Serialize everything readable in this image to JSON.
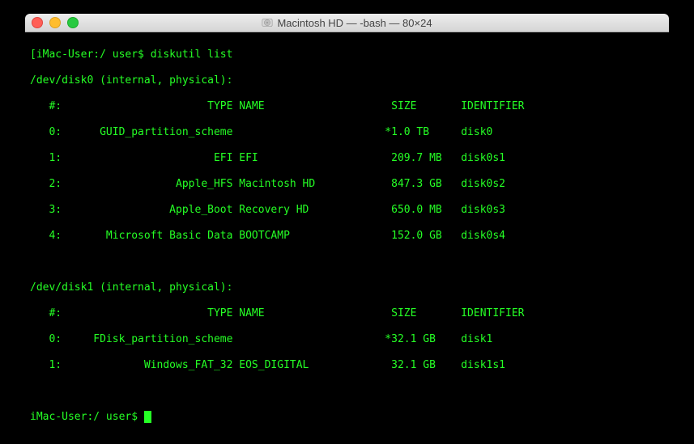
{
  "window": {
    "title": "Macintosh HD — -bash — 80×24"
  },
  "prompt1": {
    "full": "[iMac-User:/ user$ diskutil list"
  },
  "prompt2": {
    "full": "iMac-User:/ user$ "
  },
  "disk0": {
    "header": "/dev/disk0 (internal, physical):",
    "col_header": "   #:                       TYPE NAME                    SIZE       IDENTIFIER",
    "rows": [
      "   0:      GUID_partition_scheme                        *1.0 TB     disk0",
      "   1:                        EFI EFI                     209.7 MB   disk0s1",
      "   2:                  Apple_HFS Macintosh HD            847.3 GB   disk0s2",
      "   3:                 Apple_Boot Recovery HD             650.0 MB   disk0s3",
      "   4:       Microsoft Basic Data BOOTCAMP                152.0 GB   disk0s4"
    ]
  },
  "disk1": {
    "header": "/dev/disk1 (internal, physical):",
    "col_header": "   #:                       TYPE NAME                    SIZE       IDENTIFIER",
    "rows": [
      "   0:     FDisk_partition_scheme                        *32.1 GB    disk1",
      "   1:             Windows_FAT_32 EOS_DIGITAL             32.1 GB    disk1s1"
    ]
  },
  "blank": " "
}
